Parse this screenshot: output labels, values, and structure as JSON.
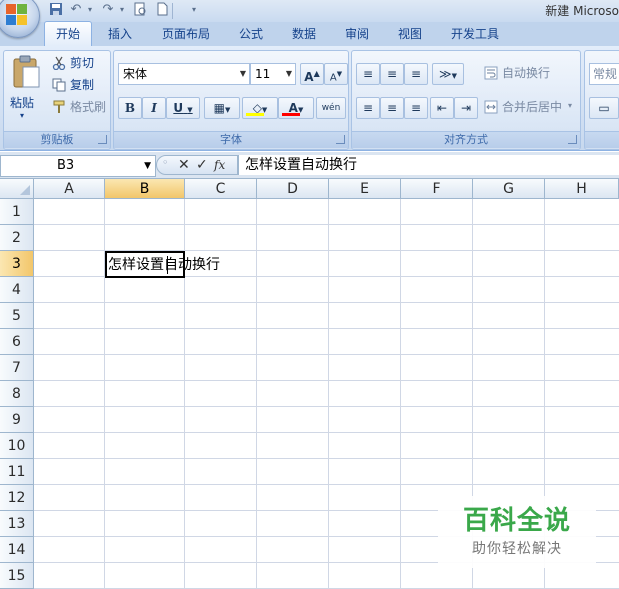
{
  "window": {
    "title": "新建 Microso"
  },
  "ribbon_tabs": [
    {
      "label": "开始",
      "active": true
    },
    {
      "label": "插入",
      "active": false
    },
    {
      "label": "页面布局",
      "active": false
    },
    {
      "label": "公式",
      "active": false
    },
    {
      "label": "数据",
      "active": false
    },
    {
      "label": "审阅",
      "active": false
    },
    {
      "label": "视图",
      "active": false
    },
    {
      "label": "开发工具",
      "active": false
    }
  ],
  "clipboard": {
    "group_label": "剪贴板",
    "paste_label": "粘贴",
    "cut_label": "剪切",
    "copy_label": "复制",
    "format_painter_label": "格式刷"
  },
  "font": {
    "group_label": "字体",
    "font_name": "宋体",
    "font_size": "11",
    "grow_label": "A",
    "shrink_label": "A",
    "bold_label": "B",
    "italic_label": "I",
    "underline_label": "U",
    "font_color_label": "A",
    "phonetic_label": "wén"
  },
  "alignment": {
    "group_label": "对齐方式",
    "wrap_text_label": "自动换行",
    "merge_center_label": "合并后居中"
  },
  "number": {
    "format_label": "常规"
  },
  "formula_bar": {
    "name_box": "B3",
    "fx_label": "fx",
    "content": "怎样设置自动换行"
  },
  "sheet": {
    "columns": [
      "A",
      "B",
      "C",
      "D",
      "E",
      "F",
      "G",
      "H"
    ],
    "rows": [
      "1",
      "2",
      "3",
      "4",
      "5",
      "6",
      "7",
      "8",
      "9",
      "10",
      "11",
      "12",
      "13",
      "14",
      "15"
    ],
    "selected_column": "B",
    "selected_row": "3",
    "active_cell": "B3",
    "active_cell_text": "怎样设置自动换行"
  },
  "watermark": {
    "title": "百科全说",
    "subtitle": "助你轻松解决"
  },
  "colors": {
    "ribbon_bg": "#d3e1f3",
    "header_selected": "#f2c66a",
    "watermark_green": "#3aa84a",
    "font_color_bar": "#ff0000",
    "fill_color_bar": "#ffff00"
  }
}
